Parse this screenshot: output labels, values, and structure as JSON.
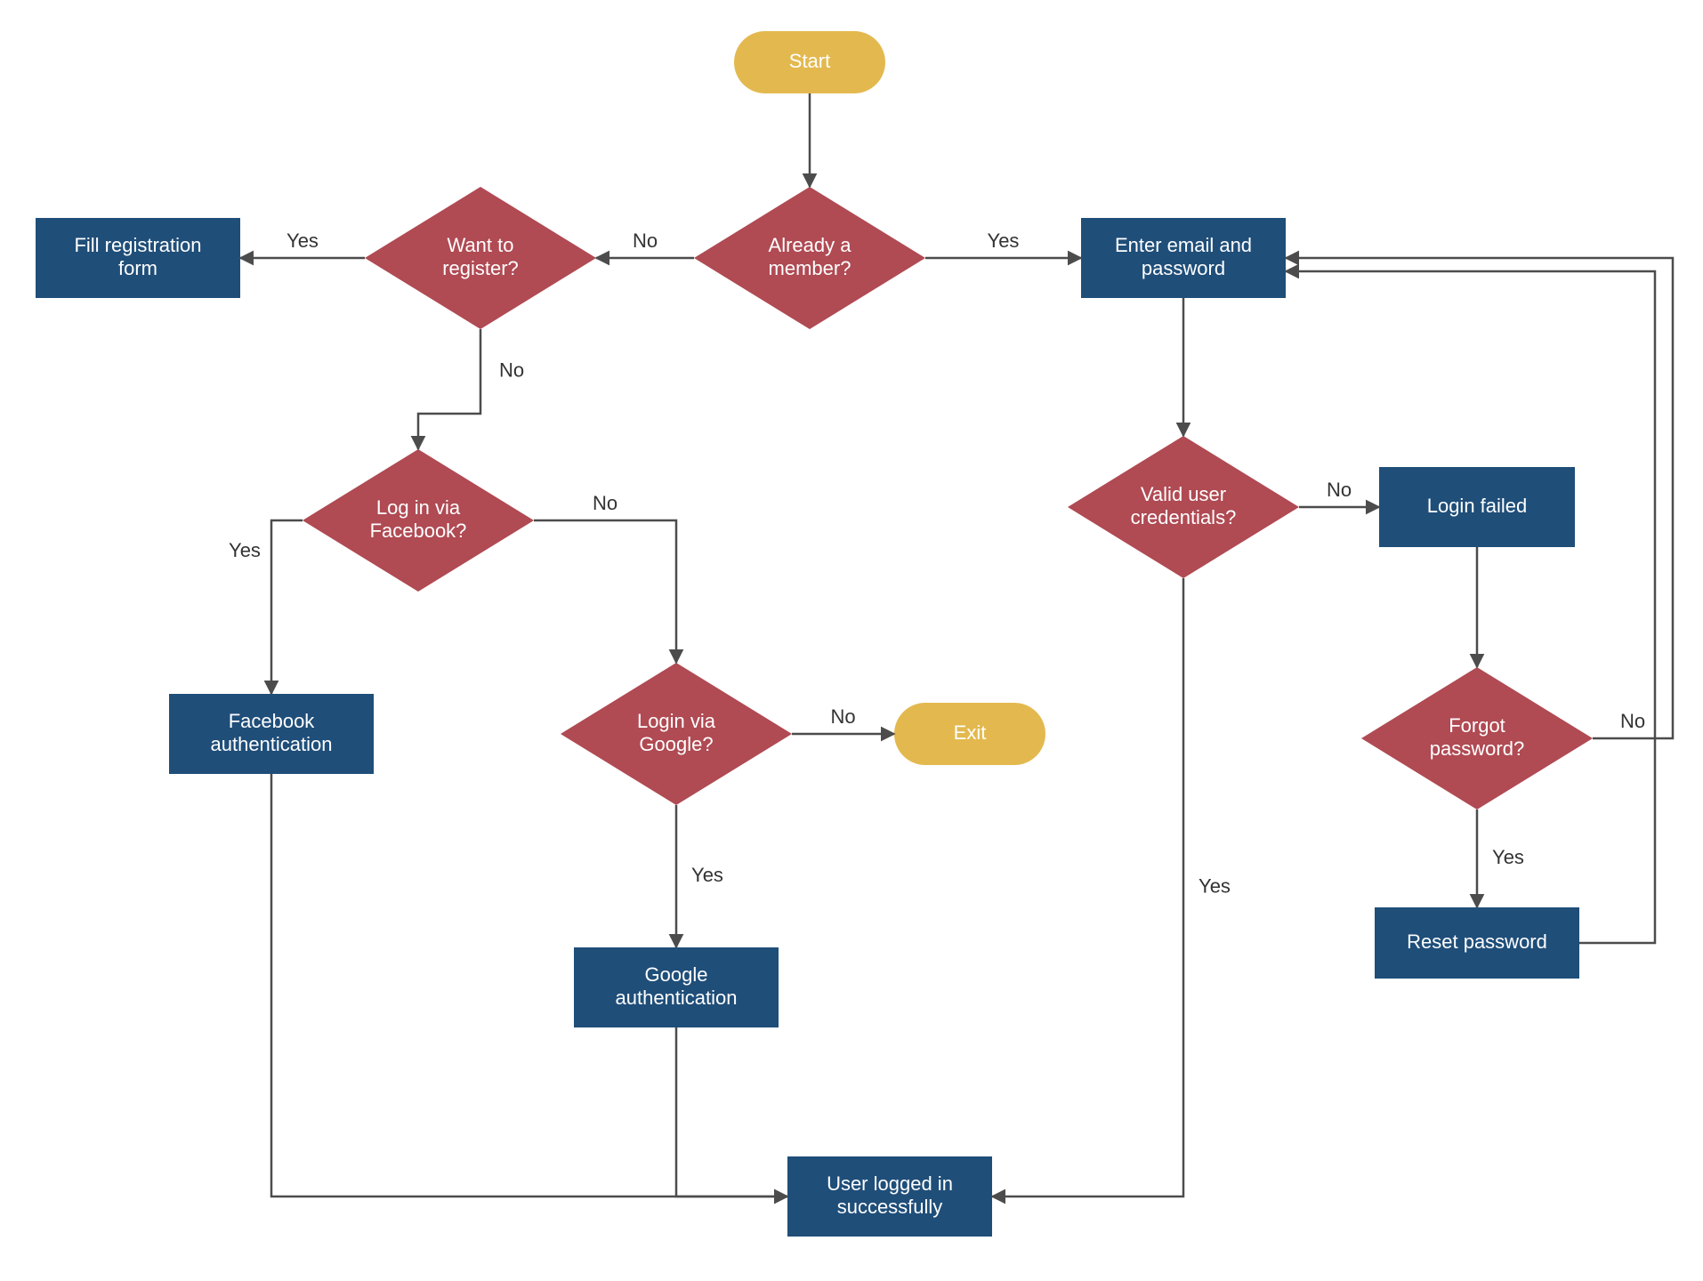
{
  "colors": {
    "terminator_fill": "#E3B94F",
    "process_fill": "#1F4E79",
    "decision_fill": "#B04A53",
    "edge_stroke": "#4c4c4c",
    "node_text": "#ffffff",
    "edge_text": "#333333"
  },
  "nodes": {
    "start": {
      "type": "terminator",
      "lines": [
        "Start"
      ]
    },
    "already_member": {
      "type": "decision",
      "lines": [
        "Already a",
        "member?"
      ]
    },
    "want_register": {
      "type": "decision",
      "lines": [
        "Want to",
        "register?"
      ]
    },
    "fill_form": {
      "type": "process",
      "lines": [
        "Fill registration",
        "form"
      ]
    },
    "login_facebook": {
      "type": "decision",
      "lines": [
        "Log in via",
        "Facebook?"
      ]
    },
    "facebook_auth": {
      "type": "process",
      "lines": [
        "Facebook",
        "authentication"
      ]
    },
    "login_google": {
      "type": "decision",
      "lines": [
        "Login via",
        "Google?"
      ]
    },
    "google_auth": {
      "type": "process",
      "lines": [
        "Google",
        "authentication"
      ]
    },
    "exit": {
      "type": "terminator",
      "lines": [
        "Exit"
      ]
    },
    "enter_email": {
      "type": "process",
      "lines": [
        "Enter email and",
        "password"
      ]
    },
    "valid_creds": {
      "type": "decision",
      "lines": [
        "Valid user",
        "credentials?"
      ]
    },
    "login_failed": {
      "type": "process",
      "lines": [
        "Login failed"
      ]
    },
    "forgot_pw": {
      "type": "decision",
      "lines": [
        "Forgot",
        "password?"
      ]
    },
    "reset_pw": {
      "type": "process",
      "lines": [
        "Reset password"
      ]
    },
    "logged_in": {
      "type": "process",
      "lines": [
        "User logged in",
        "successfully"
      ]
    }
  },
  "edge_labels": {
    "am_no": "No",
    "am_yes": "Yes",
    "wr_yes": "Yes",
    "wr_no": "No",
    "lf_yes": "Yes",
    "lf_no": "No",
    "lg_yes": "Yes",
    "lg_no": "No",
    "vc_yes": "Yes",
    "vc_no": "No",
    "fp_yes": "Yes",
    "fp_no": "No"
  }
}
